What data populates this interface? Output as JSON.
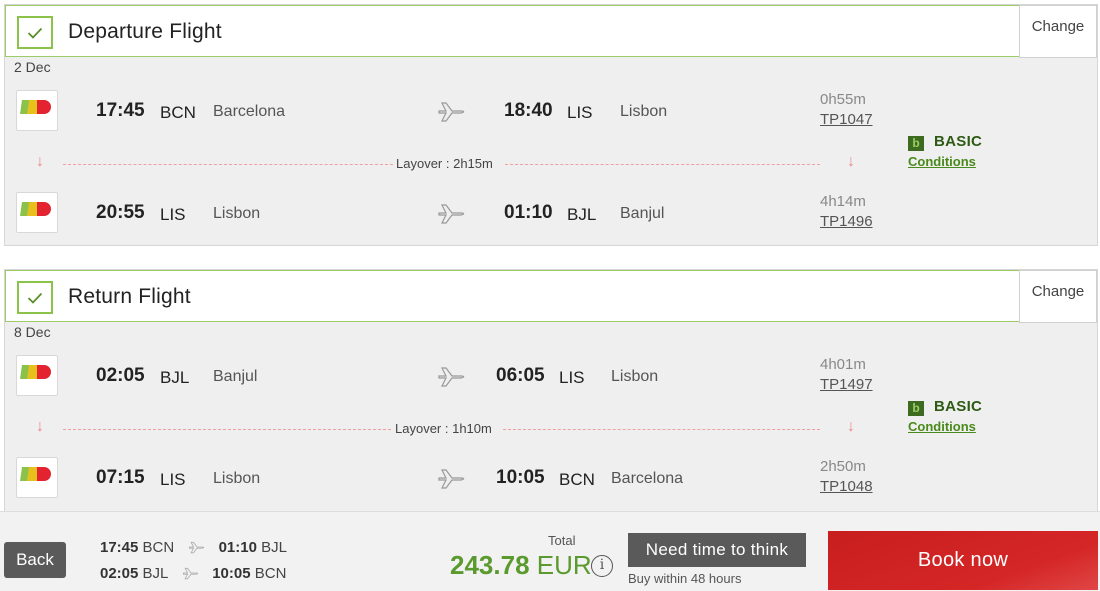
{
  "departure": {
    "title": "Departure Flight",
    "change_label": "Change",
    "date": "2 Dec",
    "segments": [
      {
        "dep_time": "17:45",
        "dep_code": "BCN",
        "dep_city": "Barcelona",
        "arr_time": "18:40",
        "arr_code": "LIS",
        "arr_city": "Lisbon",
        "duration": "0h55m",
        "flight_no": "TP1047"
      },
      {
        "dep_time": "20:55",
        "dep_code": "LIS",
        "dep_city": "Lisbon",
        "arr_time": "01:10",
        "arr_code": "BJL",
        "arr_city": "Banjul",
        "duration": "4h14m",
        "flight_no": "TP1496"
      }
    ],
    "layover": "Layover : 2h15m",
    "fare_badge": "b",
    "fare_name": "BASIC",
    "conditions": "Conditions"
  },
  "return": {
    "title": "Return Flight",
    "change_label": "Change",
    "date": "8 Dec",
    "segments": [
      {
        "dep_time": "02:05",
        "dep_code": "BJL",
        "dep_city": "Banjul",
        "arr_time": "06:05",
        "arr_code": "LIS",
        "arr_city": "Lisbon",
        "duration": "4h01m",
        "flight_no": "TP1497"
      },
      {
        "dep_time": "07:15",
        "dep_code": "LIS",
        "dep_city": "Lisbon",
        "arr_time": "10:05",
        "arr_code": "BCN",
        "arr_city": "Barcelona",
        "duration": "2h50m",
        "flight_no": "TP1048"
      }
    ],
    "layover": "Layover : 1h10m",
    "fare_badge": "b",
    "fare_name": "BASIC",
    "conditions": "Conditions"
  },
  "summary": {
    "back_label": "Back",
    "out": {
      "dep_time": "17:45",
      "dep_code": "BCN",
      "arr_time": "01:10",
      "arr_code": "BJL"
    },
    "in": {
      "dep_time": "02:05",
      "dep_code": "BJL",
      "arr_time": "10:05",
      "arr_code": "BCN"
    },
    "total_label": "Total",
    "total_amount": "243.78",
    "currency": "EUR",
    "info_icon": "i",
    "think_label": "Need time to think",
    "think_sub": "Buy within 48 hours",
    "book_label": "Book now"
  },
  "colors": {
    "accent_green": "#8bc34a",
    "price_green": "#5b9a2e",
    "book_red": "#d52626"
  },
  "icons": [
    "check-icon",
    "plane-icon",
    "tap-logo",
    "down-arrow-icon",
    "info-icon",
    "fare-badge-icon"
  ]
}
